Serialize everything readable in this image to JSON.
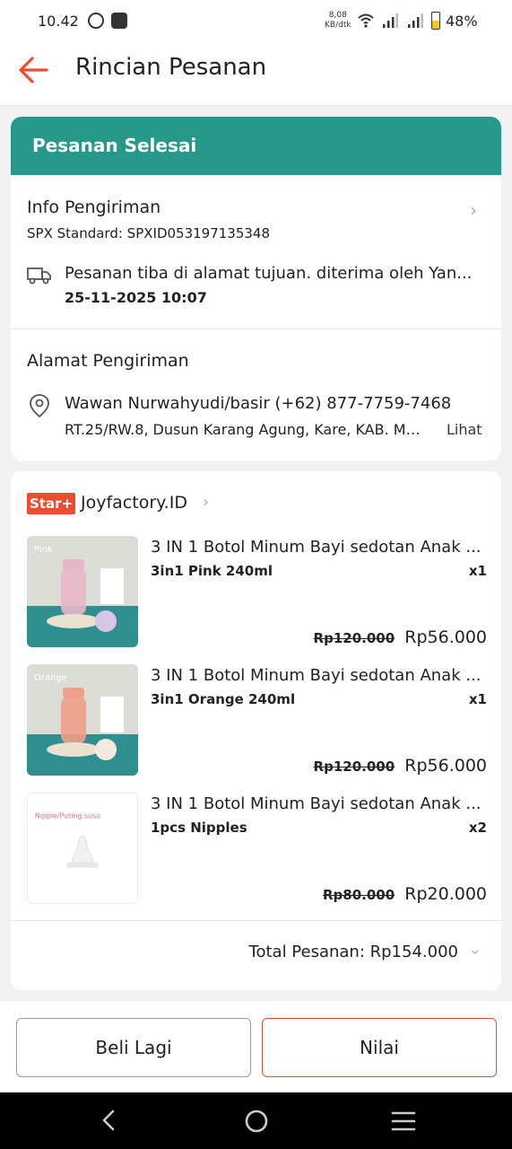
{
  "status_bar": {
    "time": "10.42",
    "net_speed_value": "8,08",
    "net_speed_unit": "KB/dtk",
    "battery": "48%",
    "battery_level": 0.48
  },
  "header": {
    "title": "Rincian Pesanan"
  },
  "order_status": "Pesanan Selesai",
  "shipping": {
    "title": "Info Pengiriman",
    "tracking": "SPX Standard: SPXID053197135348",
    "status": "Pesanan tiba di alamat tujuan. diterima oleh Yan...",
    "time": "25-11-2025 10:07"
  },
  "address": {
    "title": "Alamat Pengiriman",
    "name_phone": "Wawan Nurwahyudi/basir (+62) 877-7759-7468",
    "detail": "RT.25/RW.8, Dusun Karang Agung, Kare, KAB. MA...",
    "more": "Lihat"
  },
  "shop": {
    "badge": "Star+",
    "name": "Joyfactory.ID"
  },
  "items": [
    {
      "name": "3 IN 1 Botol Minum Bayi sedotan Anak ...",
      "variant": "3in1 Pink 240ml",
      "qty": "x1",
      "old_price": "Rp120.000",
      "price": "Rp56.000",
      "img_label": "Pink",
      "img_color": "#e7b7c8"
    },
    {
      "name": "3 IN 1 Botol Minum Bayi sedotan Anak ...",
      "variant": "3in1 Orange 240ml",
      "qty": "x1",
      "old_price": "Rp120.000",
      "price": "Rp56.000",
      "img_label": "Orange",
      "img_color": "#f0a08a"
    },
    {
      "name": "3 IN 1 Botol Minum Bayi sedotan Anak ...",
      "variant": "1pcs Nipples",
      "qty": "x2",
      "old_price": "Rp80.000",
      "price": "Rp20.000",
      "img_label": "Nipple/Puting susu",
      "img_color": "#ffffff"
    }
  ],
  "total": "Total Pesanan: Rp154.000",
  "buttons": {
    "buy_again": "Beli Lagi",
    "rate": "Nilai"
  },
  "colors": {
    "accent": "#ee4d2d",
    "banner": "#26998a",
    "teal_bg": "#2f8e8e"
  }
}
